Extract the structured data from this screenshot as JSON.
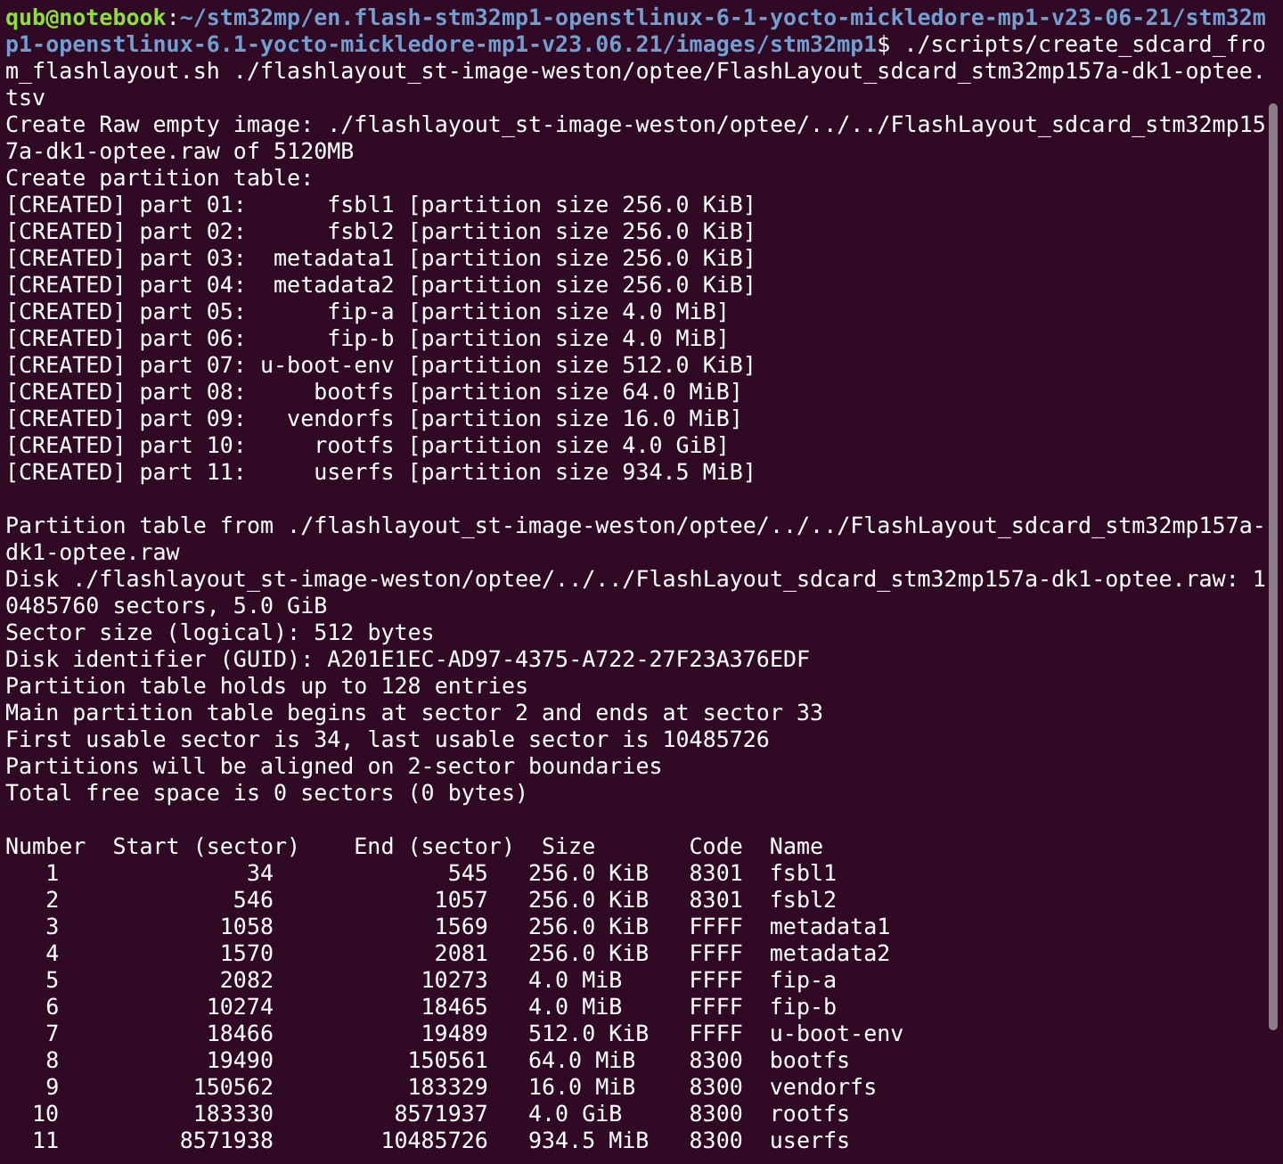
{
  "terminal": {
    "prompt": {
      "user_host": "qub@notebook",
      "separator": ":",
      "path": "~/stm32mp/en.flash-stm32mp1-openstlinux-6-1-yocto-mickledore-mp1-v23-06-21/stm32mp1-openstlinux-6.1-yocto-mickledore-mp1-v23.06.21/images/stm32mp1",
      "command": "$ ./scripts/create_sdcard_from_flashlayout.sh ./flashlayout_st-image-weston/optee/FlashLayout_sdcard_stm32mp157a-dk1-optee.tsv"
    },
    "output_blocks": [
      {
        "lines": [
          "Create Raw empty image: ./flashlayout_st-image-weston/optee/../../FlashLayout_sdcard_stm32mp157a-dk1-optee.raw of 5120MB",
          "Create partition table:",
          "[CREATED] part 01:      fsbl1 [partition size 256.0 KiB]",
          "[CREATED] part 02:      fsbl2 [partition size 256.0 KiB]",
          "[CREATED] part 03:  metadata1 [partition size 256.0 KiB]",
          "[CREATED] part 04:  metadata2 [partition size 256.0 KiB]",
          "[CREATED] part 05:      fip-a [partition size 4.0 MiB]",
          "[CREATED] part 06:      fip-b [partition size 4.0 MiB]",
          "[CREATED] part 07: u-boot-env [partition size 512.0 KiB]",
          "[CREATED] part 08:     bootfs [partition size 64.0 MiB]",
          "[CREATED] part 09:   vendorfs [partition size 16.0 MiB]",
          "[CREATED] part 10:     rootfs [partition size 4.0 GiB]",
          "[CREATED] part 11:     userfs [partition size 934.5 MiB]"
        ]
      },
      {
        "lines": [
          "Partition table from ./flashlayout_st-image-weston/optee/../../FlashLayout_sdcard_stm32mp157a-dk1-optee.raw",
          "Disk ./flashlayout_st-image-weston/optee/../../FlashLayout_sdcard_stm32mp157a-dk1-optee.raw: 10485760 sectors, 5.0 GiB",
          "Sector size (logical): 512 bytes",
          "Disk identifier (GUID): A201E1EC-AD97-4375-A722-27F23A376EDF",
          "Partition table holds up to 128 entries",
          "Main partition table begins at sector 2 and ends at sector 33",
          "First usable sector is 34, last usable sector is 10485726",
          "Partitions will be aligned on 2-sector boundaries",
          "Total free space is 0 sectors (0 bytes)"
        ]
      }
    ],
    "partition_table": {
      "columns": [
        "Number",
        "Start (sector)",
        "End (sector)",
        "Size",
        "Code",
        "Name"
      ],
      "rows": [
        [
          "1",
          "34",
          "545",
          "256.0 KiB",
          "8301",
          "fsbl1"
        ],
        [
          "2",
          "546",
          "1057",
          "256.0 KiB",
          "8301",
          "fsbl2"
        ],
        [
          "3",
          "1058",
          "1569",
          "256.0 KiB",
          "FFFF",
          "metadata1"
        ],
        [
          "4",
          "1570",
          "2081",
          "256.0 KiB",
          "FFFF",
          "metadata2"
        ],
        [
          "5",
          "2082",
          "10273",
          "4.0 MiB",
          "FFFF",
          "fip-a"
        ],
        [
          "6",
          "10274",
          "18465",
          "4.0 MiB",
          "FFFF",
          "fip-b"
        ],
        [
          "7",
          "18466",
          "19489",
          "512.0 KiB",
          "FFFF",
          "u-boot-env"
        ],
        [
          "8",
          "19490",
          "150561",
          "64.0 MiB",
          "8300",
          "bootfs"
        ],
        [
          "9",
          "150562",
          "183329",
          "16.0 MiB",
          "8300",
          "vendorfs"
        ],
        [
          "10",
          "183330",
          "8571937",
          "4.0 GiB",
          "8300",
          "rootfs"
        ],
        [
          "11",
          "8571938",
          "10485726",
          "934.5 MiB",
          "8300",
          "userfs"
        ]
      ]
    }
  }
}
